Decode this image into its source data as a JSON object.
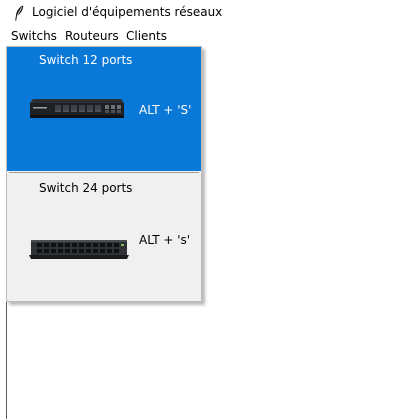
{
  "window": {
    "title": "Logiciel d'équipements réseaux",
    "app_icon": "feather-icon"
  },
  "menubar": {
    "items": [
      {
        "label": "Switchs"
      },
      {
        "label": "Routeurs"
      },
      {
        "label": "Clients"
      }
    ]
  },
  "dropdown": {
    "items": [
      {
        "label": "Switch 12 ports",
        "shortcut": "ALT + 'S'",
        "image": "switch-12-ports-image",
        "highlighted": true
      },
      {
        "label": "Switch 24 ports",
        "shortcut": "ALT + 's'",
        "image": "switch-24-ports-image",
        "highlighted": false
      }
    ]
  },
  "colors": {
    "highlight": "#0a78d7",
    "menu_bg": "#f0f0f0"
  }
}
